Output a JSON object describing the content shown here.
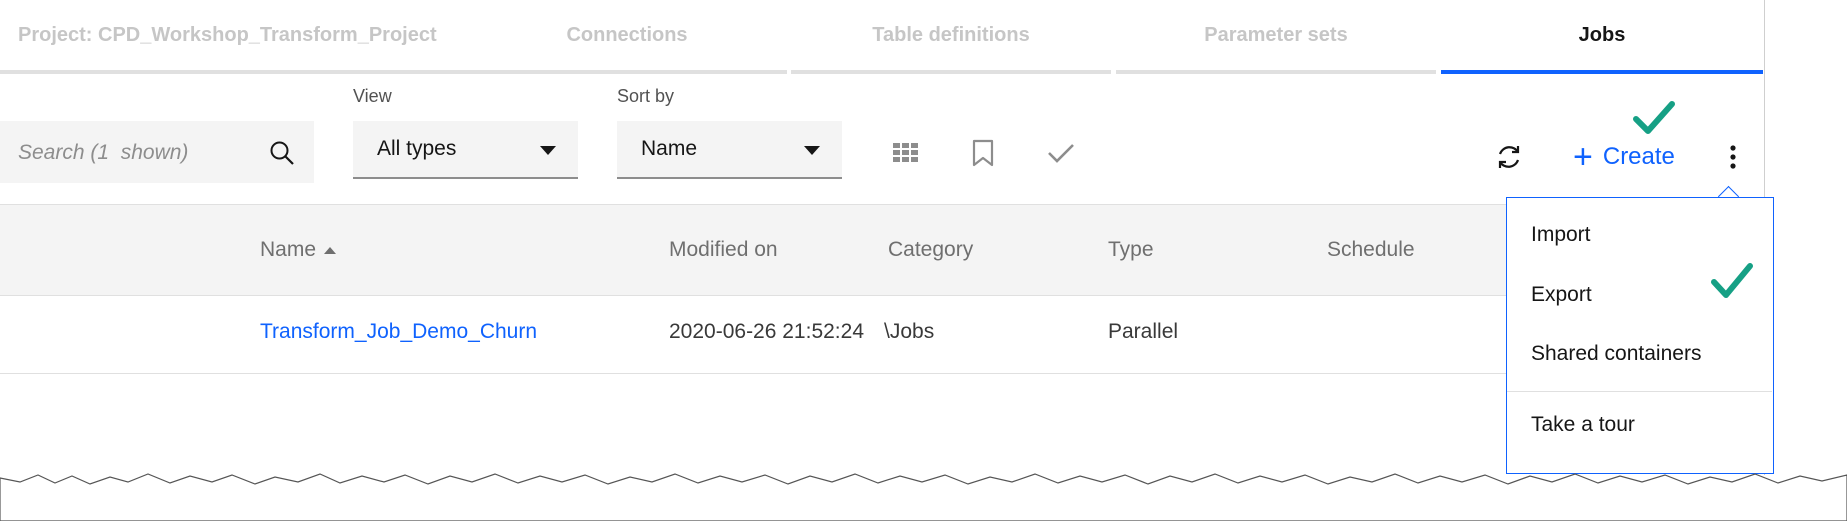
{
  "tabs": [
    {
      "label": "Project: CPD_Workshop_Transform_Project"
    },
    {
      "label": "Connections"
    },
    {
      "label": "Table definitions"
    },
    {
      "label": "Parameter sets"
    },
    {
      "label": "Jobs",
      "active": true
    }
  ],
  "toolbar": {
    "search_placeholder": "Search (1  shown)",
    "view_label": "View",
    "view_value": "All types",
    "sort_label": "Sort by",
    "sort_value": "Name",
    "create_label": "Create"
  },
  "table": {
    "columns": [
      "Name",
      "Modified on",
      "Category",
      "Type",
      "Schedule"
    ],
    "rows": [
      {
        "name": "Transform_Job_Demo_Churn",
        "modified": "2020-06-26 21:52:24",
        "category": "\\Jobs",
        "type": "Parallel",
        "schedule": ""
      }
    ]
  },
  "menu": {
    "items": [
      "Import",
      "Export",
      "Shared containers",
      "Take a tour"
    ]
  },
  "colors": {
    "accent": "#0f62fe",
    "checkmark": "#16a085"
  },
  "icons": [
    "search-icon",
    "chevron-down-icon",
    "grid-icon",
    "bookmark-icon",
    "checkmark-icon",
    "refresh-icon",
    "plus-icon",
    "overflow-menu-icon",
    "sort-ascending-icon"
  ]
}
